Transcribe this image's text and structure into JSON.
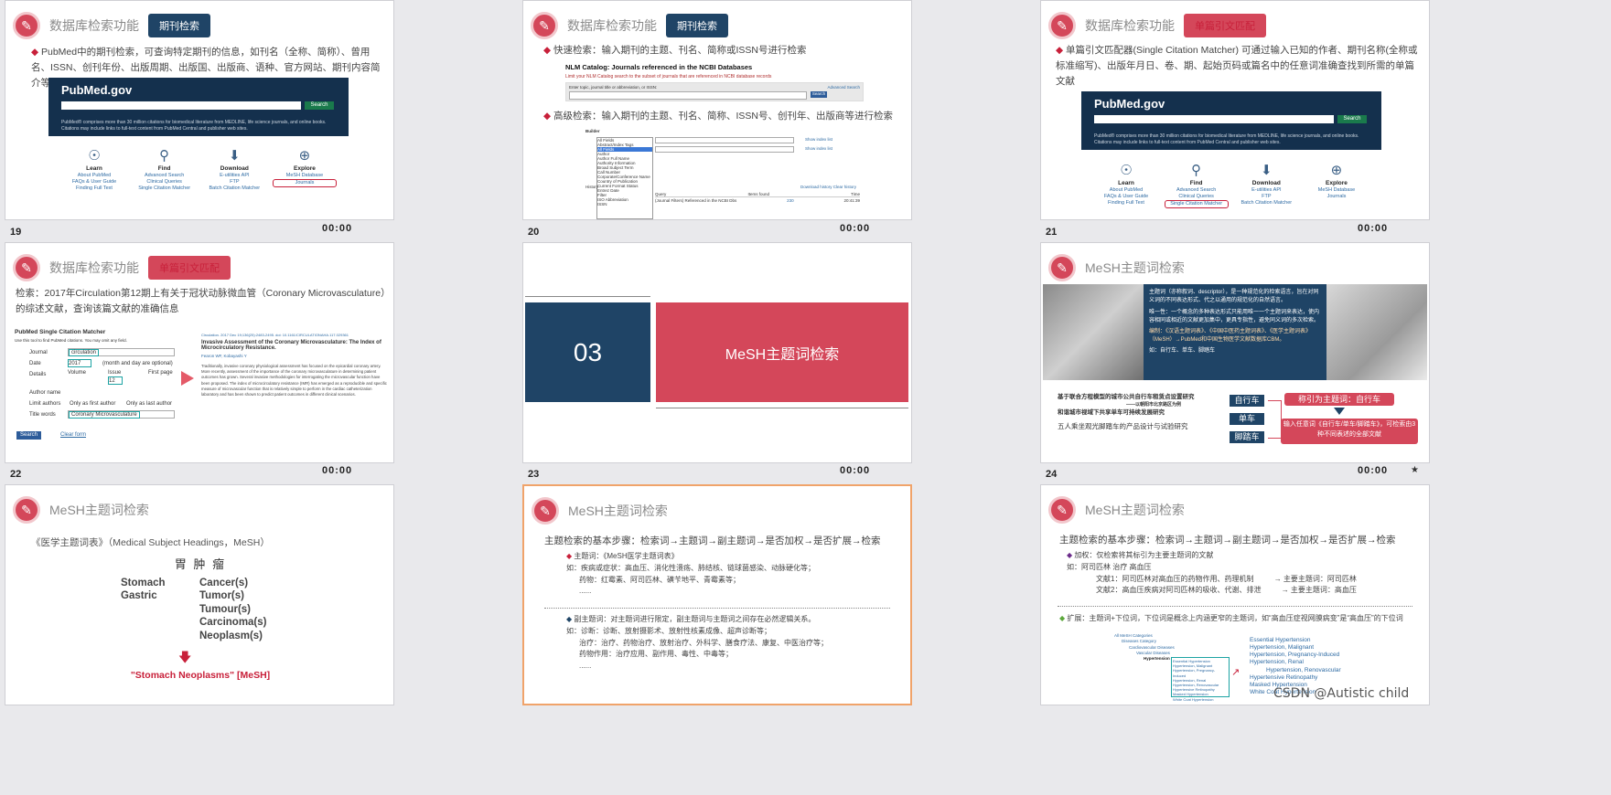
{
  "slides": [
    {
      "number": "19",
      "time": "00:00",
      "title": "数据库检索功能",
      "tag": "期刊检索",
      "text": "PubMed中的期刊检索，可查询特定期刊的信息，如刊名（全称、简称）、曾用名、ISSN、创刊年份、出版周期、出版国、出版商、语种、官方网站、期刊内容简介等。",
      "pubmed": {
        "logo": "PubMed.gov",
        "placeholder": "Search PubMed",
        "search": "Search",
        "advanced": "Advanced",
        "desc": "PubMed® comprises more than 30 million citations for biomedical literature from MEDLINE, life science journals, and online books. Citations may include links to full-text content from PubMed Central and publisher web sites.",
        "cols": [
          {
            "title": "Learn",
            "links": [
              "About PubMed",
              "FAQs & User Guide",
              "Finding Full Text"
            ]
          },
          {
            "title": "Find",
            "links": [
              "Advanced Search",
              "Clinical Queries",
              "Single Citation Matcher"
            ]
          },
          {
            "title": "Download",
            "links": [
              "E-utilities API",
              "FTP",
              "Batch Citation Matcher"
            ]
          },
          {
            "title": "Explore",
            "links": [
              "MeSH Database",
              "Journals"
            ]
          }
        ]
      }
    },
    {
      "number": "20",
      "time": "00:00",
      "title": "数据库检索功能",
      "tag": "期刊检索",
      "quick": "快速检索：输入期刊的主题、刊名、简称或ISSN号进行检索",
      "nlm_title": "NLM Catalog: Journals referenced in the NCBI Databases",
      "nlm_sub": "Limit your NLM Catalog search to the subset of journals that are referenced in NCBI database records",
      "nlm_label": "Enter topic, journal title or abbreviation, or ISSN:",
      "nlm_adv": "Advanced Search",
      "nlm_btn": "Search",
      "advanced": "高级检索：输入期刊的主题、刊名、简称、ISSN号、创刊年、出版商等进行检索",
      "builder": "Builder",
      "fields": [
        "All Fields",
        "AND",
        "Abstract/Index Tags",
        "All Fields",
        "Author",
        "Author Full Name",
        "Authority Information",
        "Broad Subject Term",
        "Call Number",
        "Corporate/Conference Name",
        "Country of Publication",
        "Current Format Status",
        "Entrez Date",
        "Filter",
        "ISO Abbreviation",
        "ISSN"
      ],
      "show_index": "Show index list",
      "history": "History",
      "download": "Download history",
      "clear": "Clear history",
      "table_head": [
        "Search",
        "Add to builder",
        "Query",
        "Items found",
        "Time"
      ],
      "table_row": [
        "#1",
        "Add",
        "(Journal Filters) Referenced in the NCBI Dbs",
        "230",
        "20:41:39"
      ]
    },
    {
      "number": "21",
      "time": "00:00",
      "title": "数据库检索功能",
      "tag": "单篇引文匹配",
      "text": "单篇引文匹配器(Single Citation Matcher) 可通过输入已知的作者、期刊名称(全称或标准缩写)、出版年月日、卷、期、起始页码或篇名中的任意词准确查找到所需的单篇文献"
    },
    {
      "number": "22",
      "time": "00:00",
      "title": "数据库检索功能",
      "tag": "单篇引文匹配",
      "text": "检索：2017年Circulation第12期上有关于冠状动脉微血管（Coronary Microvasculature）的综述文献，查询该篇文献的准确信息",
      "scm_title": "PubMed Single Citation Matcher",
      "scm_sub": "Use this tool to find PubMed citations. You may omit any field.",
      "rows": [
        {
          "label": "Journal",
          "value": "circulation"
        },
        {
          "label": "Date",
          "value": "2017"
        },
        {
          "label": "Details",
          "value": "12"
        },
        {
          "label": "Author name",
          "value": ""
        },
        {
          "label": "Limit authors",
          "value": ""
        },
        {
          "label": "Title words",
          "value": "Coronary Microvasculature"
        }
      ],
      "date_hint": "(month and day are optional)",
      "vol": "Volume",
      "issue": "Issue",
      "first_page": "First page",
      "only_first": "Only as first author",
      "only_last": "Only as last author",
      "search": "Search",
      "clear": "Clear form",
      "article_cite": "Circulation. 2017 Dec 19;136(25):2483-2495. doi: 10.1161/CIRCULATIONAHA.117.029361",
      "article_title": "Invasive Assessment of the Coronary Microvasculature: The Index of Microcirculatory Resistance.",
      "authors": "Fearon WF, Kobayashi Y",
      "abstract": "Traditionally, invasive coronary physiological assessment has focused on the epicardial coronary artery. More recently, assessment of the importance of the coronary microvasculature in determining patient outcomes has grown. Several invasive methodologies for interrogating the microvascular function have been proposed. The index of microcirculatory resistance (IMR) has emerged as a reproducible and specific measure of microvascular function that is relatively simple to perform in the cardiac catheterization laboratory and has been shown to predict patient outcomes in different clinical scenarios."
    },
    {
      "number": "23",
      "time": "00:00",
      "section_num": "03",
      "section_title": "MeSH主题词检索"
    },
    {
      "number": "24",
      "time": "00:00",
      "title": "MeSH主题词检索",
      "p1": "主题词（亦称叙词、descriptor），是一种规范化的检索语言，旨在对同义词的不同表达形式、代之以通用的规范化的自然语言。",
      "p2": "唯一性：一个概念的多种表达形式只能用唯一一个主题词来表达，使内容相同或相近的文献更加集中，更具专指性，避免同义词的多次检索。",
      "p3": "编制：《汉语主题词表》、《中国中医药主题词表》、《医学主题词表》（MeSH）→PubMed和中国生物医学文献数据库CBM。",
      "p4": "如：自行车、单车、脚踏车",
      "a1": "基于联合方程模型的城市公共自行车租赁点设置研究",
      "a1b": "——以朝阳市北京路区为例",
      "a2": "和谐城市视域下共享单车可持续发展研究",
      "a3": "五人乘坐观光脚踏车的产品设计与试验研究",
      "btns": [
        "自行车",
        "单车",
        "脚踏车"
      ],
      "right1": "称引为主题词：自行车",
      "right2": "输入任意词《自行车/单车/脚踏车》，可检索由3种不同表述的全部文献"
    },
    {
      "number": "",
      "time": "",
      "title": "MeSH主题词检索",
      "line": "《医学主题词表》（Medical Subject Headings，MeSH）",
      "cn": "胃 肿 瘤",
      "left": [
        "Stomach",
        "Gastric"
      ],
      "right": [
        "Cancer(s)",
        "Tumor(s)",
        "Tumour(s)",
        "Carcinoma(s)",
        "Neoplasm(s)"
      ],
      "result": "\"Stomach Neoplasms\" [MeSH]"
    },
    {
      "number": "",
      "time": "",
      "title": "MeSH主题词检索",
      "steps": "主题检索的基本步骤：检索词→主题词→副主题词→是否加权→是否扩展→检索",
      "s1": "主题词：《MeSH医学主题词表》",
      "s1a": "如：疾病或症状：高血压、消化性溃疡、肺结核、链球菌感染、动脉硬化等；",
      "s1b": "药物：红霉素、阿司匹林、磺苄地平、青霉素等；",
      "s1c": "......",
      "s2": "副主题词：对主题词进行限定，副主题词与主题词之间存在必然逻辑关系。",
      "s2a": "如：诊断：诊断、放射摄影术、放射性核素成像、超声诊断等；",
      "s2b": "治疗：治疗、药物治疗、放射治疗、外科学、膳食疗法、康复、中医治疗等；",
      "s2c": "药物作用：治疗应用、副作用、毒性、中毒等；",
      "s2d": "......"
    },
    {
      "number": "",
      "time": "",
      "title": "MeSH主题词检索",
      "steps": "主题检索的基本步骤：检索词→主题词→副主题词→是否加权→是否扩展→检索",
      "w1": "加权：仅检索将其标引为主要主题词的文献",
      "w2": "如：阿司匹林 治疗 高血压",
      "w3": "文献1：阿司匹林对高血压的药物作用、药理机制",
      "w3r": "→ 主要主题词：阿司匹林",
      "w4": "文献2：高血压疾病对阿司匹林的吸收、代谢、排泄",
      "w4r": "→ 主要主题词：高血压",
      "e1": "扩展：主题词+下位词，下位词是概念上内涵更窄的主题词，如“高血压症视网膜病变”是“高血压”的下位词",
      "tree": [
        "All MeSH Categories",
        "Diseases Category",
        "Cardiovascular Diseases",
        "Vascular Diseases",
        "Hypertension"
      ],
      "list": [
        "Essential Hypertension",
        "Hypertension, Malignant",
        "Hypertension, Pregnancy-Induced",
        "Hypertension, Renal",
        "Hypertension, Renovascular",
        "Hypertensive Retinopathy",
        "Masked Hypertension",
        "White Coat Hypertension"
      ],
      "watermark": "CSDN @Autistic child"
    }
  ]
}
